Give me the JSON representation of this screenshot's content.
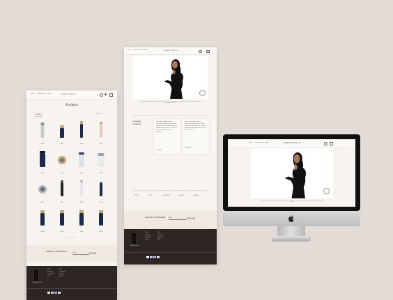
{
  "brand": {
    "logo": "MARIE EDELLE"
  },
  "nav": {
    "items": [
      "Shop",
      "Professionals",
      "About",
      "Contact"
    ],
    "icons": [
      "search-icon",
      "user-icon",
      "bag-icon"
    ]
  },
  "products_page": {
    "title": "Products",
    "filters": [
      "Filter",
      "Sort by"
    ],
    "product_label": "Luxury Skincare Product",
    "price": "$98.00",
    "pagination": "1 2 3 4 5"
  },
  "home_page": {
    "caption": "Lorem ipsum dolor sit amet, consectetur adipiscing elit, sed do eiusmod tempor incididunt ut labore et dolore magna aliqua. Ut enim ad minim veniam.",
    "testimonials_heading": "Customer Feedback",
    "reviews": [
      {
        "text": "Lorem ipsum dolor sit amet, consectetur adipiscing elit, sed do eiusmod tempor incididunt ut labore et dolore magna aliqua. Ut enim ad minim veniam, quis nostrud exercitation.",
        "author": "Jane Doe"
      },
      {
        "text": "Lorem ipsum dolor sit amet, consectetur adipiscing elit, sed do eiusmod tempor incididunt ut labore et dolore magna aliqua. Ut enim ad minim veniam.",
        "author": "John Smith"
      }
    ],
    "press": [
      "VOGUE",
      "ELLE",
      "GLAMOUR",
      "ALLURE",
      "BAZAAR"
    ]
  },
  "subscribe": {
    "heading": "Subscribe to Our Newsletter",
    "placeholder": "Email",
    "button": "Submit"
  },
  "footer": {
    "columns": [
      {
        "title": "About",
        "items": [
          "Our Story",
          "Ingredients",
          "Press",
          "Careers"
        ]
      },
      {
        "title": "Help",
        "items": [
          "Contact Us",
          "Shipping",
          "Returns",
          "FAQ"
        ]
      }
    ],
    "payments": [
      "VISA",
      "MC",
      "AMEX",
      "PAY"
    ]
  },
  "colors": {
    "background": "#e3dcd6",
    "page": "#f7f4f0",
    "footer": "#2d2624",
    "accent": "#b0404a",
    "navy": "#1c2a4a",
    "gold": "#c9a46b"
  }
}
